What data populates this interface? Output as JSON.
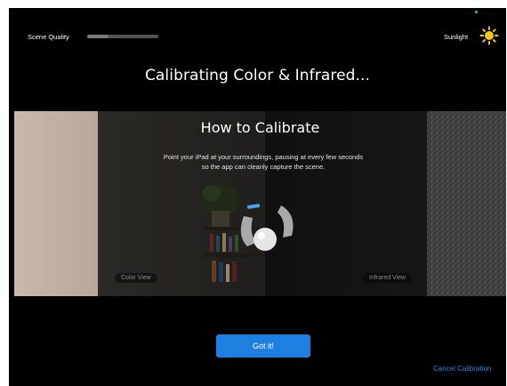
{
  "status": {
    "scene_quality_label": "Scene Quality",
    "scene_quality_level": 0.3,
    "lighting_label": "Sunlight",
    "lighting_icon": "sun-icon"
  },
  "title": "Calibrating Color & Infrared...",
  "instructions": {
    "title": "How to Calibrate",
    "line1": "Point your iPad at your surroundings, pausing at every few seconds",
    "line2": "so the app can cleanly capture the scene.",
    "color_view_label": "Color View",
    "infrared_view_label": "Infrared View"
  },
  "actions": {
    "got_it_label": "Got it!",
    "cancel_label": "Cancel Calibration"
  },
  "colors": {
    "accent": "#1f7fe0",
    "link": "#2f86e6",
    "sun": "#f5c518",
    "status_dot": "#3fd04a"
  }
}
